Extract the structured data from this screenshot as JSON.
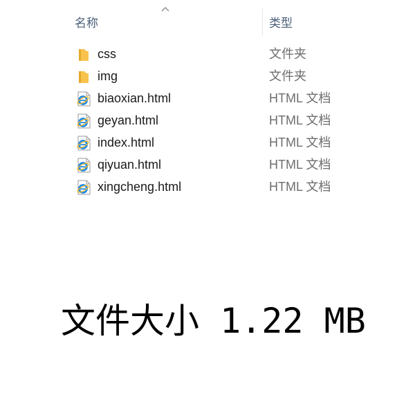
{
  "explorer": {
    "columns": {
      "name_label": "名称",
      "type_label": "类型",
      "sort_indicator": "ascending"
    },
    "files": [
      {
        "name": "css",
        "type": "文件夹",
        "icon": "folder-icon"
      },
      {
        "name": "img",
        "type": "文件夹",
        "icon": "folder-icon"
      },
      {
        "name": "biaoxian.html",
        "type": "HTML 文档",
        "icon": "ie-html-icon"
      },
      {
        "name": "geyan.html",
        "type": "HTML 文档",
        "icon": "ie-html-icon"
      },
      {
        "name": "index.html",
        "type": "HTML 文档",
        "icon": "ie-html-icon"
      },
      {
        "name": "qiyuan.html",
        "type": "HTML 文档",
        "icon": "ie-html-icon"
      },
      {
        "name": "xingcheng.html",
        "type": "HTML 文档",
        "icon": "ie-html-icon"
      }
    ],
    "colors": {
      "header_text": "#4c607a",
      "folder": "#f7c34c",
      "ie_blue": "#1e88e5",
      "ie_orbit": "#f2b51d"
    }
  },
  "caption": {
    "text": "文件大小 1.22 MB"
  }
}
